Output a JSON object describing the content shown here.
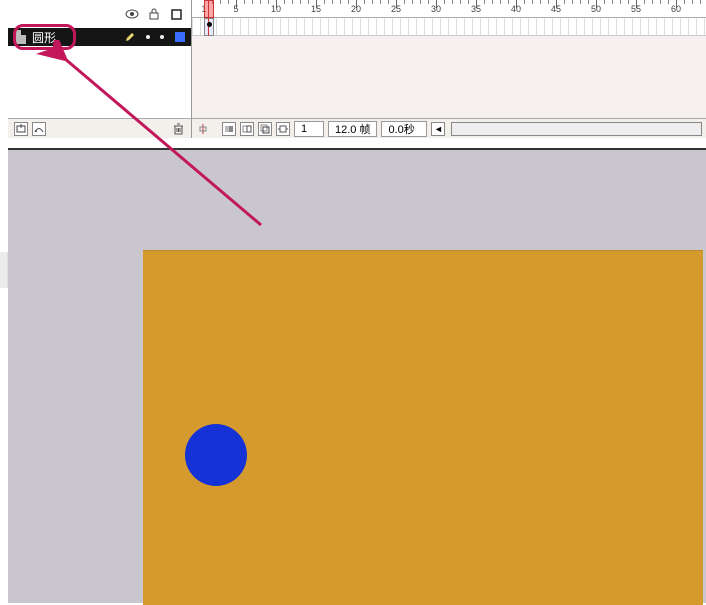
{
  "layer": {
    "name": "圆形",
    "visible_icon": "eye-icon",
    "lock_icon": "lock-icon",
    "outline_icon": "square-outline-icon"
  },
  "ruler": {
    "start": 1,
    "step": 5,
    "labels": [
      "1",
      "5",
      "10",
      "15",
      "20",
      "25",
      "30",
      "35",
      "40",
      "45",
      "50",
      "55",
      "60"
    ]
  },
  "footer": {
    "current_frame": "1",
    "fps": "12.0 帧",
    "time": "0.0秒"
  },
  "layer_footer": {
    "add_layer": "add-layer",
    "add_folder": "add-folder",
    "delete": "delete"
  },
  "icons": {
    "eye": "◉",
    "lock": "🔒",
    "square": "□",
    "plus": "⊞",
    "folder": "▣",
    "trash": "🗑",
    "leftarrow": "◄"
  }
}
